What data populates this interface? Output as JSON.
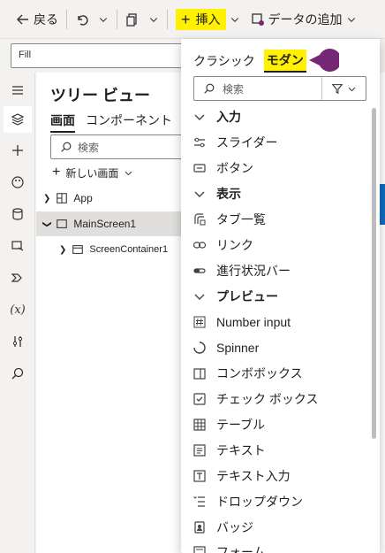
{
  "toolbar": {
    "back_label": "戻る",
    "insert_label": "挿入",
    "add_data_label": "データの追加"
  },
  "formula": {
    "property": "Fill"
  },
  "tree": {
    "title": "ツリー ビュー",
    "tab_screens": "画面",
    "tab_components": "コンポーネント",
    "search_placeholder": "検索",
    "new_screen_label": "新しい画面",
    "items": [
      {
        "label": "App"
      },
      {
        "label": "MainScreen1"
      },
      {
        "label": "ScreenContainer1"
      }
    ]
  },
  "insert_panel": {
    "tab_classic": "クラシック",
    "tab_modern": "モダン",
    "search_placeholder": "検索",
    "sections": [
      {
        "header": "入力",
        "items": [
          "スライダー",
          "ボタン"
        ]
      },
      {
        "header": "表示",
        "items": [
          "タブ一覧",
          "リンク",
          "進行状況バー"
        ]
      },
      {
        "header": "プレビュー",
        "items": [
          "Number input",
          "Spinner",
          "コンボボックス",
          "チェック ボックス",
          "テーブル",
          "テキスト",
          "テキスト入力",
          "ドロップダウン",
          "バッジ",
          "フォーム"
        ]
      }
    ]
  },
  "colors": {
    "highlight": "#fff100",
    "accent": "#742774",
    "selected_row": "#e1dfdd"
  }
}
